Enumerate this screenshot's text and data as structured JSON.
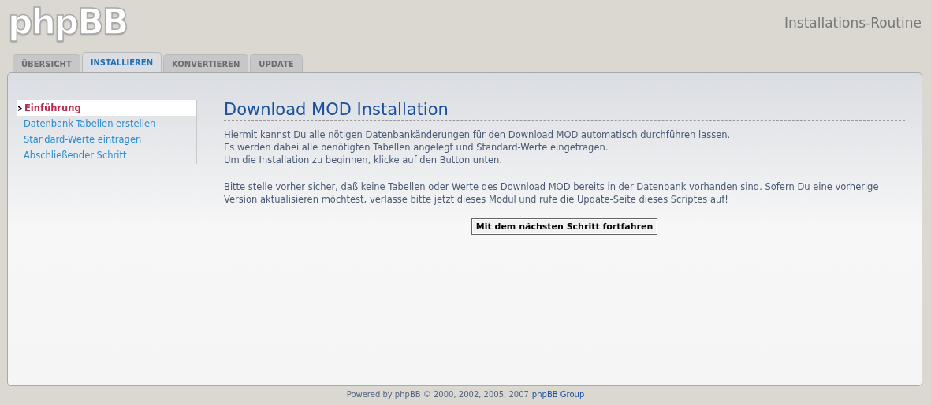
{
  "header": {
    "logo": "phpBB",
    "title": "Installations-Routine"
  },
  "tabs": [
    {
      "label": "ÜBERSICHT",
      "selected": false
    },
    {
      "label": "INSTALLIEREN",
      "selected": true
    },
    {
      "label": "KONVERTIEREN",
      "selected": false
    },
    {
      "label": "UPDATE",
      "selected": false
    }
  ],
  "sidebar": {
    "items": [
      {
        "label": "Einführung",
        "selected": true
      },
      {
        "label": "Datenbank-Tabellen erstellen",
        "selected": false
      },
      {
        "label": "Standard-Werte eintragen",
        "selected": false
      },
      {
        "label": "Abschließender Schritt",
        "selected": false
      }
    ]
  },
  "content": {
    "heading": "Download MOD Installation",
    "paragraphs": [
      [
        "Hiermit kannst Du alle nötigen Datenbankänderungen für den Download MOD automatisch durchführen lassen.",
        "Es werden dabei alle benötigten Tabellen angelegt und Standard-Werte eingetragen.",
        "Um die Installation zu beginnen, klicke auf den Button unten."
      ],
      [
        "Bitte stelle vorher sicher, daß keine Tabellen oder Werte des Download MOD bereits in der Datenbank vorhanden sind. Sofern Du eine vorherige Version aktualisieren möchtest, verlasse bitte jetzt dieses Modul und rufe die Update-Seite dieses Scriptes auf!"
      ]
    ],
    "button": "Mit dem nächsten Schritt fortfahren"
  },
  "footer": {
    "text": "Powered by phpBB © 2000, 2002, 2005, 2007",
    "link": "phpBB Group"
  }
}
